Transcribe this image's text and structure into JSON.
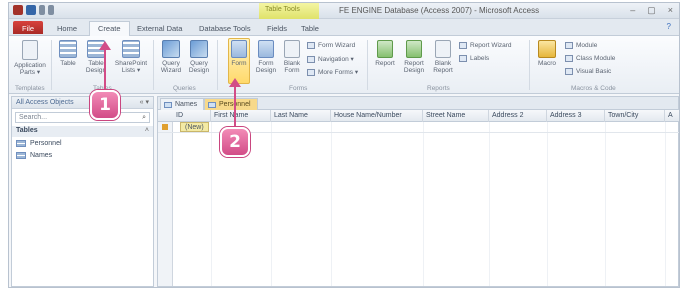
{
  "window": {
    "title": "FE ENGINE Database (Access 2007) - Microsoft Access",
    "contextual_tab_band": "Table Tools",
    "controls": [
      "–",
      "▢",
      "×"
    ]
  },
  "ribbon_tabs": {
    "file": "File",
    "home": "Home",
    "create": "Create",
    "external": "External Data",
    "dbtools": "Database Tools",
    "fields": "Fields",
    "table": "Table",
    "help": "?"
  },
  "ribbon": {
    "templates": {
      "app_parts": "Application Parts ▾",
      "label": "Templates"
    },
    "tables": {
      "table": "Table",
      "table_design": "Table Design",
      "sharepoint": "SharePoint Lists ▾",
      "label": "Tables"
    },
    "queries": {
      "wizard": "Query Wizard",
      "design": "Query Design",
      "label": "Queries"
    },
    "forms": {
      "form": "Form",
      "form_design": "Form Design",
      "blank_form": "Blank Form",
      "form_wizard": "Form Wizard",
      "navigation": "Navigation ▾",
      "more_forms": "More Forms ▾",
      "label": "Forms"
    },
    "reports": {
      "report": "Report",
      "report_design": "Report Design",
      "blank_report": "Blank Report",
      "report_wizard": "Report Wizard",
      "labels": "Labels",
      "label": "Reports"
    },
    "macros": {
      "macro": "Macro",
      "module": "Module",
      "class_module": "Class Module",
      "visual_basic": "Visual Basic",
      "label": "Macros & Code"
    }
  },
  "nav_pane": {
    "header": "All Access Objects",
    "search_placeholder": "Search...",
    "group": "Tables",
    "items": [
      "Personnel",
      "Names"
    ]
  },
  "document": {
    "tabs": [
      "Names",
      "Personnel"
    ],
    "columns": [
      "ID",
      "First Name",
      "Last Name",
      "House Name/Number",
      "Street Name",
      "Address 2",
      "Address 3",
      "Town/City",
      "A"
    ],
    "new_row_cell": "(New)"
  },
  "callouts": [
    "1",
    "2"
  ],
  "colors": {
    "accent_file": "#a92a26",
    "callout": "#d24c87",
    "highlight": "#ffd96b"
  }
}
